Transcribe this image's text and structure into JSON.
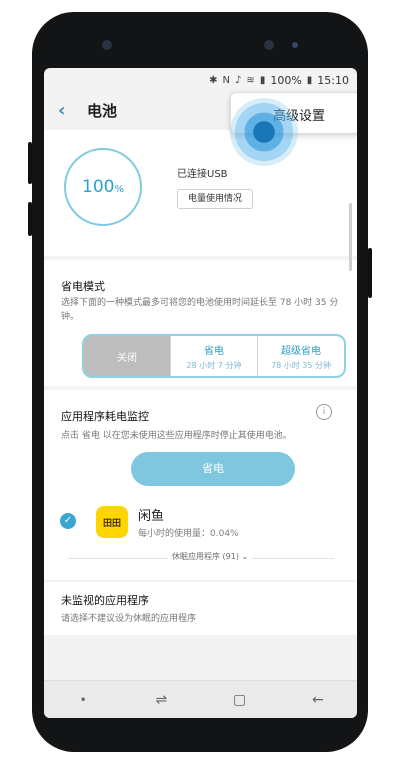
{
  "statusbar": {
    "battery": "100%",
    "time": "15:10"
  },
  "header": {
    "title": "电池",
    "menu": {
      "advanced_settings": "高级设置"
    }
  },
  "battery": {
    "percent": "100",
    "percent_unit": "%",
    "status": "已连接USB",
    "usage_button": "电量使用情况"
  },
  "power_saving": {
    "title": "省电模式",
    "description": "选择下面的一种模式最多可将您的电池使用时间延长至 78 小时 35 分钟。",
    "modes": [
      {
        "label": "关闭",
        "sub": ""
      },
      {
        "label": "省电",
        "sub": "28 小时 7 分钟"
      },
      {
        "label": "超级省电",
        "sub": "78 小时 35 分钟"
      }
    ],
    "selected_mode": "关闭"
  },
  "app_monitor": {
    "title": "应用程序耗电监控",
    "description": "点击 省电 以在您未使用这些应用程序时停止其使用电池。",
    "save_button": "省电",
    "apps": [
      {
        "name": "闲鱼",
        "icon_text": "田田",
        "usage": "每小时的使用量：0.04%"
      }
    ],
    "sleeping_apps": "休眠应用程序 (91)"
  },
  "unmonitored": {
    "title": "未监视的应用程序",
    "description": "请选择不建议设为休眠的应用程序"
  },
  "colors": {
    "accent": "#39a6cf",
    "ring": "#7ecbe2",
    "button": "#7ec7df"
  }
}
